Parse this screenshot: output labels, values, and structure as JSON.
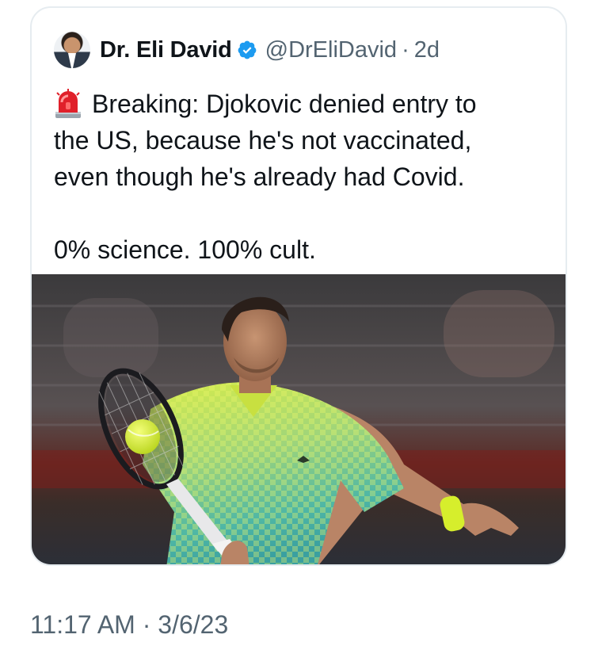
{
  "tweet": {
    "author": {
      "display_name": "Dr. Eli David",
      "handle": "@DrEliDavid",
      "verified": true,
      "avatar_icon": "profile-photo"
    },
    "separator": "·",
    "age": "2d",
    "text_lines": [
      "Breaking: Djokovic denied entry to",
      "the US, because he's not vaccinated,",
      "even though he's already had Covid."
    ],
    "text_line_2": "0% science. 100% cult.",
    "leading_emoji": "police-car-light-icon",
    "media": {
      "type": "photo",
      "subject": "tennis player hitting forehand"
    }
  },
  "footer": {
    "timestamp": "11:17 AM · 3/6/23"
  },
  "colors": {
    "text": "#0f1419",
    "secondary": "#536471",
    "verified_blue": "#1d9bf0",
    "border": "#e6ecf0"
  }
}
